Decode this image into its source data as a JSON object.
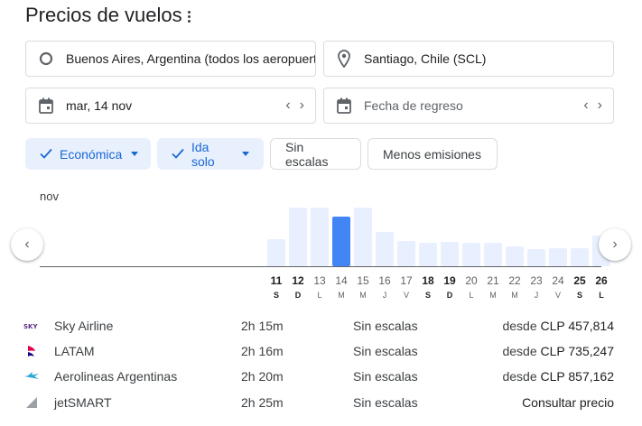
{
  "header": {
    "title": "Precios de vuelos"
  },
  "search": {
    "origin": "Buenos Aires, Argentina (todos los aeropuertos)",
    "destination": "Santiago, Chile (SCL)",
    "departure_date": "mar, 14 nov",
    "return_placeholder": "Fecha de regreso"
  },
  "filters": {
    "cabin": "Económica",
    "trip_type": "Ida solo",
    "nonstop": "Sin escalas",
    "emissions": "Menos emisiones"
  },
  "chart_data": {
    "type": "bar",
    "month_label": "nov",
    "categories": [
      "11",
      "12",
      "13",
      "14",
      "15",
      "16",
      "17",
      "18",
      "19",
      "20",
      "21",
      "22",
      "23",
      "24",
      "25",
      "26"
    ],
    "weekdays": [
      "S",
      "D",
      "L",
      "M",
      "M",
      "J",
      "V",
      "S",
      "D",
      "L",
      "M",
      "M",
      "J",
      "V",
      "S",
      "L"
    ],
    "bold_days": [
      "11",
      "12",
      "18",
      "19",
      "25",
      "26"
    ],
    "values": [
      30,
      65,
      65,
      55,
      65,
      38,
      28,
      26,
      27,
      26,
      26,
      22,
      19,
      20,
      20,
      34
    ],
    "selected": "14",
    "ylim": [
      0,
      70
    ],
    "colors": {
      "bar": "#e8efff",
      "selected": "#4285f4"
    }
  },
  "flights": [
    {
      "airline": "Sky Airline",
      "logo": "sky-airline-logo",
      "duration": "2h 15m",
      "stops": "Sin escalas",
      "price_prefix": "desde ",
      "price": "CLP 457,814"
    },
    {
      "airline": "LATAM",
      "logo": "latam-logo",
      "duration": "2h 16m",
      "stops": "Sin escalas",
      "price_prefix": "desde ",
      "price": "CLP 735,247"
    },
    {
      "airline": "Aerolineas Argentinas",
      "logo": "aerolineas-argentinas-logo",
      "duration": "2h 20m",
      "stops": "Sin escalas",
      "price_prefix": "desde ",
      "price": "CLP 857,162"
    },
    {
      "airline": "jetSMART",
      "logo": "jetsmart-logo",
      "duration": "2h 25m",
      "stops": "Sin escalas",
      "price_prefix": "",
      "price": "Consultar precio"
    }
  ]
}
